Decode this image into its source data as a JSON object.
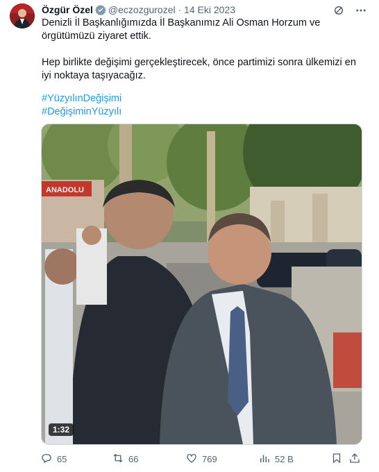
{
  "author": {
    "name": "Özgür Özel",
    "handle": "@eczozgurozel",
    "separator": "·",
    "date": "14 Eki 2023"
  },
  "tweet": {
    "paragraph1": "Denizli İl Başkanlığımızda İl Başkanımız Ali Osman Horzum ve örgütümüzü ziyaret ettik.",
    "paragraph2": "Hep birlikte değişimi gerçekleştirecek, önce partimizi sonra ülkemizi en iyi noktaya taşıyacağız.",
    "hashtags": [
      "#YüzyılınDeğişimi",
      "#DeğişiminYüzyılı"
    ]
  },
  "media": {
    "type": "video",
    "duration": "1:32",
    "signage_text": "ANADOLU"
  },
  "actions": {
    "replies": "65",
    "reposts": "66",
    "likes": "769",
    "views": "52 B"
  },
  "colors": {
    "link": "#1d9bf0",
    "muted": "#536471",
    "verified": "#829aab"
  },
  "icons": [
    "grok-icon",
    "more-icon",
    "verified-badge-icon",
    "reply-icon",
    "repost-icon",
    "like-icon",
    "views-icon",
    "bookmark-icon",
    "share-icon"
  ]
}
